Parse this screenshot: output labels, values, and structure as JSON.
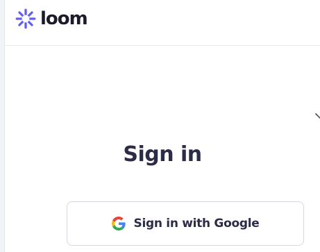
{
  "brand": {
    "name": "loom",
    "logo_icon": "loom-starburst-icon",
    "logo_color": "#625df5"
  },
  "signin": {
    "title": "Sign in",
    "google_button_label": "Sign in with Google",
    "google_icon": "google-g-icon"
  },
  "colors": {
    "title_text": "#2d2c48",
    "background": "#ffffff",
    "gutter": "#f2f3f6",
    "border": "#d5d8de"
  }
}
